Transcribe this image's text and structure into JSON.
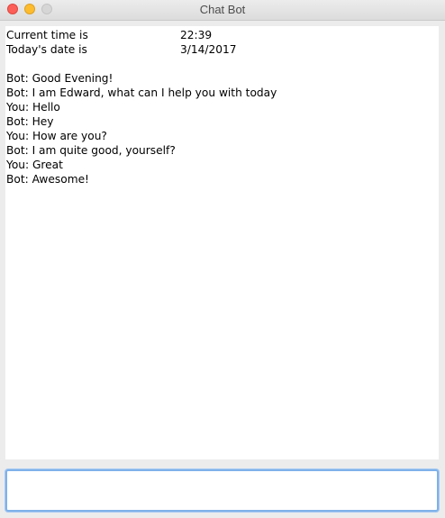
{
  "window": {
    "title": "Chat Bot"
  },
  "info": {
    "time_label": "Current time is",
    "time_value": "22:39",
    "date_label": "Today's date is",
    "date_value": "3/14/2017"
  },
  "messages": [
    "Bot: Good Evening!",
    "Bot: I am Edward, what can I help you with today",
    "You: Hello",
    "Bot: Hey",
    "You: How are you?",
    "Bot: I am quite good, yourself?",
    "You: Great",
    "Bot: Awesome!"
  ],
  "input": {
    "value": ""
  },
  "colors": {
    "close": "#fc5f57",
    "minimize": "#fdbc2e",
    "maximize_disabled": "#d6d6d6",
    "input_focus": "#7fb1ea"
  }
}
